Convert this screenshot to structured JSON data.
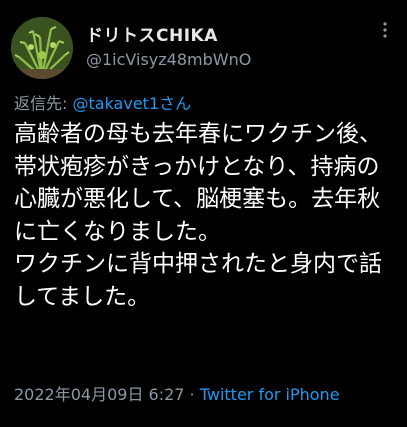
{
  "author": {
    "display_name": "ドリトスCHIKA",
    "handle": "@1icVisyz48mbWnO"
  },
  "menu": {
    "icon": "more-vertical-icon"
  },
  "reply": {
    "label": "返信先: ",
    "mention": "@takavet1さん"
  },
  "tweet": {
    "text": "高齢者の母も去年春にワクチン後、帯状疱疹がきっかけとなり、持病の心臓が悪化して、脳梗塞も。去年秋に亡くなりました。\nワクチンに背中押されたと身内で話してました。"
  },
  "meta": {
    "timestamp": "2022年04月09日 6:27",
    "separator": " · ",
    "client": "Twitter for iPhone"
  },
  "colors": {
    "background": "#000000",
    "text": "#ffffff",
    "secondary": "#8b98a5",
    "link": "#1d9bf0"
  }
}
